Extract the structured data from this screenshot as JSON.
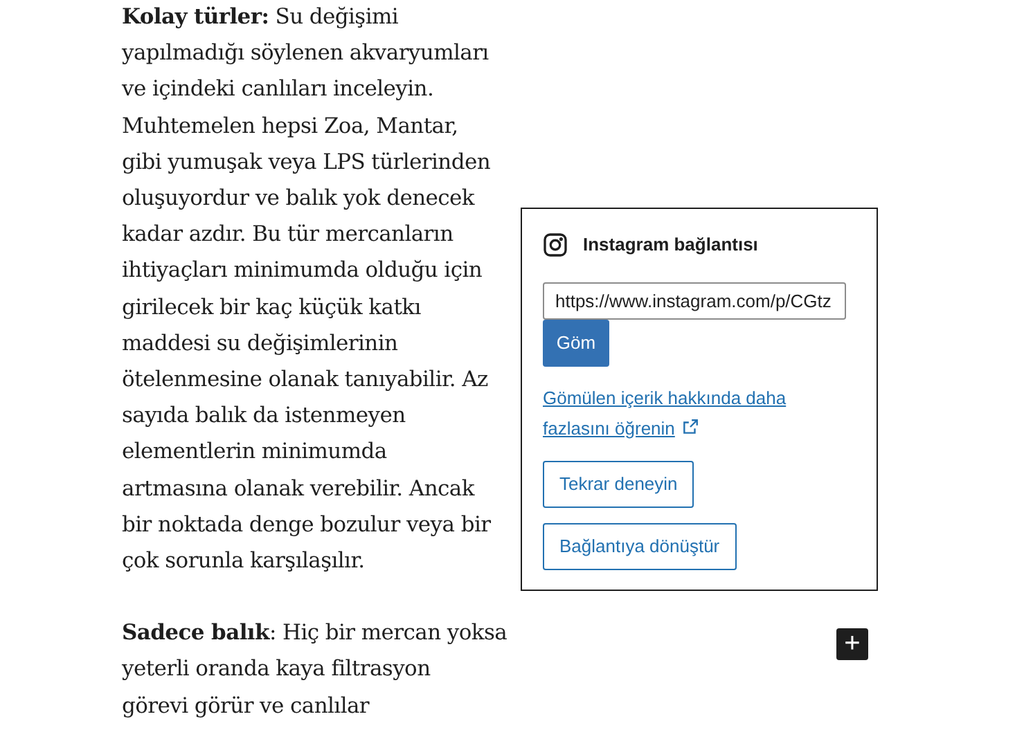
{
  "article": {
    "paragraphs": [
      {
        "lines": [
          "**Kolay türler:** Su değişimi",
          "yapılmadığı söylenen akvaryumları",
          "ve içindeki canlıları inceleyin.",
          "Muhtemelen hepsi Zoa, Mantar,",
          "gibi yumuşak veya LPS türlerinden",
          "oluşuyordur ve balık yok denecek",
          "kadar azdır. Bu tür mercanların",
          "ihtiyaçları minimumda olduğu için",
          "girilecek bir kaç küçük katkı",
          "maddesi su değişimlerinin",
          "ötelenmesine olanak tanıyabilir. Az",
          "sayıda balık da istenmeyen",
          "elementlerin minimumda",
          "artmasına olanak verebilir. Ancak",
          "bir noktada denge bozulur veya bir",
          "çok sorunla karşılaşılır."
        ]
      },
      {
        "lines": [
          "**Sadece balık**: Hiç bir mercan yoksa",
          "yeterli oranda kaya filtrasyon",
          "görevi görür ve canlılar"
        ]
      }
    ]
  },
  "embed": {
    "title": "Instagram bağlantısı",
    "url": "https://www.instagram.com/p/CGtz",
    "embed_button": "Göm",
    "learn_more": "Gömülen içerik hakkında daha fazlasını öğrenin",
    "buttons": [
      "Tekrar deneyin",
      "Bağlantıya dönüştür"
    ]
  },
  "add_block_button": {
    "symbol": "+"
  }
}
